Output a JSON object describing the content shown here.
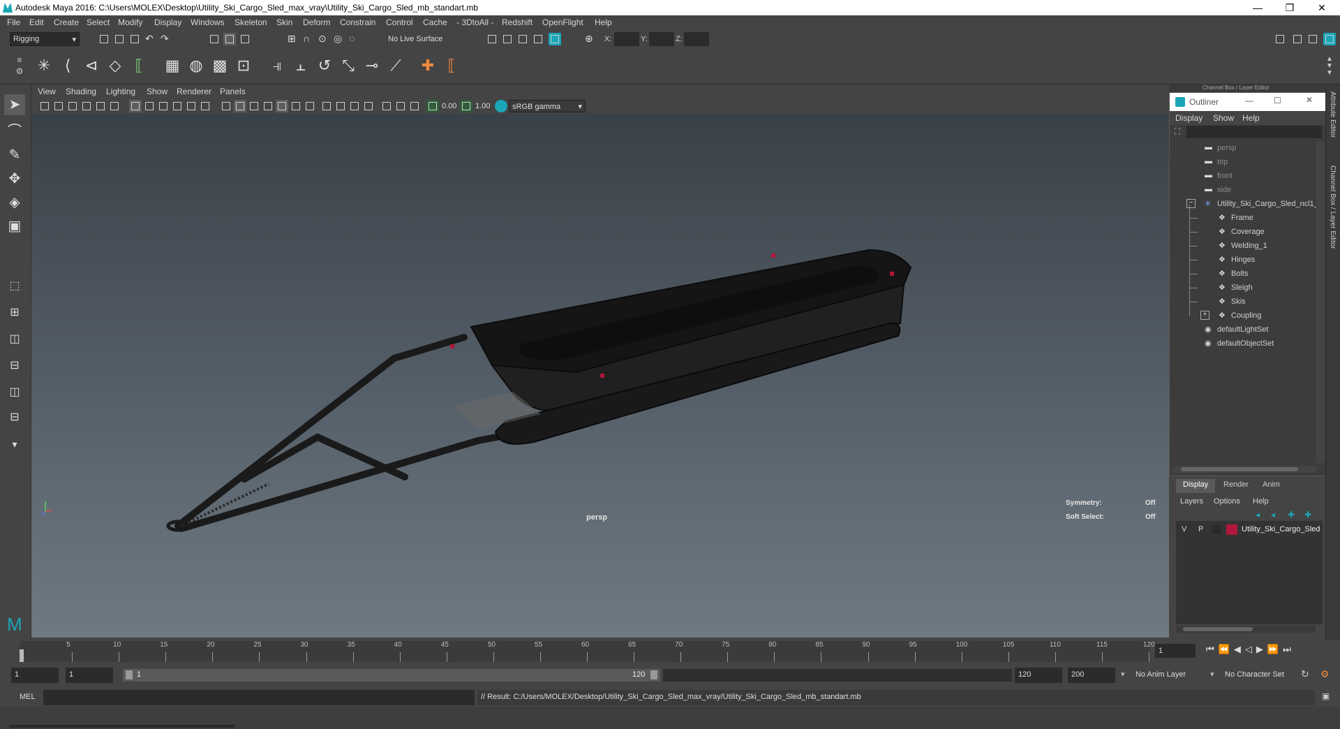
{
  "window": {
    "title": "Autodesk Maya 2016: C:\\Users\\MOLEX\\Desktop\\Utility_Ski_Cargo_Sled_max_vray\\Utility_Ski_Cargo_Sled_mb_standart.mb",
    "minimize": "—",
    "restore": "❐",
    "close": "✕"
  },
  "menubar": [
    "File",
    "Edit",
    "Create",
    "Select",
    "Modify",
    "Display",
    "Windows",
    "Skeleton",
    "Skin",
    "Deform",
    "Constrain",
    "Control",
    "Cache",
    "- 3DtoAll -",
    "Redshift",
    "OpenFlight",
    "Help"
  ],
  "statusline": {
    "mode": "Rigging",
    "live_surface": "No Live Surface",
    "x_label": "X:",
    "y_label": "Y:",
    "z_label": "Z:"
  },
  "viewport_menu": [
    "View",
    "Shading",
    "Lighting",
    "Show",
    "Renderer",
    "Panels"
  ],
  "viewport_toolbar": {
    "near_value": "0.00",
    "far_value": "1.00",
    "color_space": "sRGB gamma"
  },
  "viewport": {
    "camera_label": "persp",
    "symmetry_label": "Symmetry:",
    "symmetry_value": "Off",
    "soft_select_label": "Soft Select:",
    "soft_select_value": "Off"
  },
  "channel_box_header": "Channel Box / Layer Editor",
  "outliner": {
    "title": "Outliner",
    "menu": [
      "Display",
      "Show",
      "Help"
    ],
    "items": [
      {
        "label": "persp",
        "icon": "camera-icon",
        "indent": 0,
        "dim": true
      },
      {
        "label": "top",
        "icon": "camera-icon",
        "indent": 0,
        "dim": true
      },
      {
        "label": "front",
        "icon": "camera-icon",
        "indent": 0,
        "dim": true
      },
      {
        "label": "side",
        "icon": "camera-icon",
        "indent": 0,
        "dim": true
      },
      {
        "label": "Utility_Ski_Cargo_Sled_ncl1_",
        "icon": "group-icon",
        "indent": 0,
        "dim": false,
        "expander": "−"
      },
      {
        "label": "Frame",
        "icon": "mesh-icon",
        "indent": 1,
        "dim": false
      },
      {
        "label": "Coverage",
        "icon": "mesh-icon",
        "indent": 1,
        "dim": false
      },
      {
        "label": "Welding_1",
        "icon": "mesh-icon",
        "indent": 1,
        "dim": false
      },
      {
        "label": "Hinges",
        "icon": "mesh-icon",
        "indent": 1,
        "dim": false
      },
      {
        "label": "Bolts",
        "icon": "mesh-icon",
        "indent": 1,
        "dim": false
      },
      {
        "label": "Sleigh",
        "icon": "mesh-icon",
        "indent": 1,
        "dim": false
      },
      {
        "label": "Skis",
        "icon": "mesh-icon",
        "indent": 1,
        "dim": false
      },
      {
        "label": "Coupling",
        "icon": "mesh-icon",
        "indent": 1,
        "dim": false,
        "expander": "+"
      },
      {
        "label": "defaultLightSet",
        "icon": "set-icon",
        "indent": 0,
        "dim": false
      },
      {
        "label": "defaultObjectSet",
        "icon": "set-icon",
        "indent": 0,
        "dim": false
      }
    ]
  },
  "layer_editor": {
    "tabs": [
      "Display",
      "Render",
      "Anim"
    ],
    "menu": [
      "Layers",
      "Options",
      "Help"
    ],
    "layer": {
      "v": "V",
      "p": "P",
      "name": "Utility_Ski_Cargo_Sled",
      "color": "#b0173a"
    }
  },
  "side_tabs": [
    "Attribute Editor",
    "Channel Box / Layer Editor"
  ],
  "timeslider": {
    "ticks": [
      "5",
      "10",
      "15",
      "20",
      "25",
      "30",
      "35",
      "40",
      "45",
      "50",
      "55",
      "60",
      "65",
      "70",
      "75",
      "80",
      "85",
      "90",
      "95",
      "100",
      "105",
      "110",
      "115",
      "120"
    ],
    "first": "1",
    "current_frame": "1"
  },
  "rangeslider": {
    "start": "1",
    "playback_start": "1",
    "range_start_label": "1",
    "range_end_label": "120",
    "playback_end": "120",
    "end": "200",
    "anim_layer": "No Anim Layer",
    "character_set": "No Character Set"
  },
  "cmdline": {
    "label": "MEL",
    "result": "// Result: C:/Users/MOLEX/Desktop/Utility_Ski_Cargo_Sled_max_vray/Utility_Ski_Cargo_Sled_mb_standart.mb"
  },
  "colors": {
    "accent": "#1aa6b7",
    "layer_red": "#b0173a",
    "sled": "#1c1c1c"
  }
}
